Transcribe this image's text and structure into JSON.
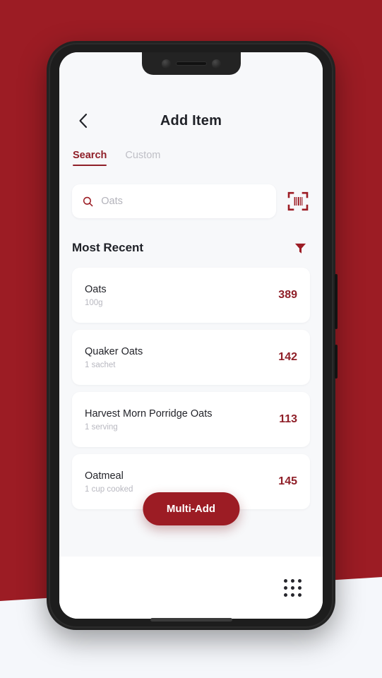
{
  "theme": {
    "backdrop_red": "#9C1C24",
    "backdrop_light": "#F5F7FB",
    "accent": "#8F1F28",
    "text_dark": "#1F2127",
    "text_muted": "#B8B8C0"
  },
  "header": {
    "title": "Add Item",
    "back_icon": "chevron-left-icon"
  },
  "tabs": [
    {
      "label": "Search",
      "active": true
    },
    {
      "label": "Custom",
      "active": false
    }
  ],
  "search": {
    "placeholder": "Oats",
    "value": "",
    "icon": "search-icon",
    "scan_icon": "barcode-scan-icon"
  },
  "section": {
    "title": "Most Recent",
    "filter_icon": "filter-funnel-icon"
  },
  "food_list": [
    {
      "name": "Oats",
      "portion": "100g",
      "kcal": "389"
    },
    {
      "name": "Quaker Oats",
      "portion": "1 sachet",
      "kcal": "142"
    },
    {
      "name": "Harvest Morn Porridge Oats",
      "portion": "1 serving",
      "kcal": "113"
    },
    {
      "name": "Oatmeal",
      "portion": "1 cup cooked",
      "kcal": "145"
    }
  ],
  "fab": {
    "label": "Multi-Add"
  },
  "bottom_bar": {
    "grid_icon": "grid-dots-icon"
  }
}
